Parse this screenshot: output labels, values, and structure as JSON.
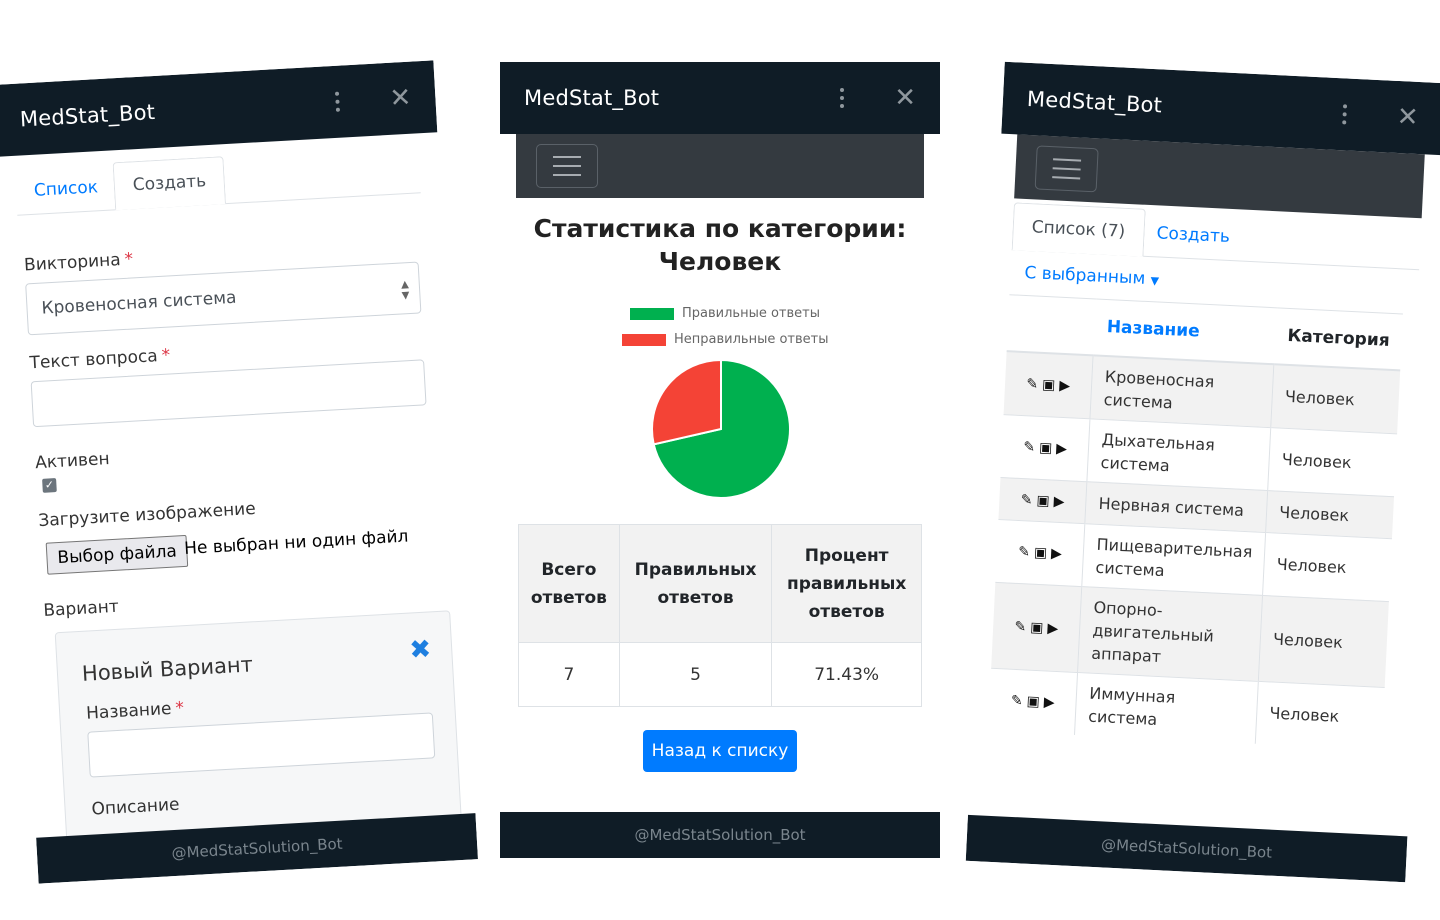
{
  "app_title": "MedStat_Bot",
  "footer_text": "@MedStatSolution_Bot",
  "colors": {
    "bar_bg": "#0f1c26",
    "navbar_bg": "#343a40",
    "primary": "#007bff",
    "correct": "#00b04f",
    "incorrect": "#f44336"
  },
  "form_screen": {
    "tabs": [
      "Список",
      "Создать"
    ],
    "quiz_label": "Викторина",
    "quiz_value": "Кровеносная система",
    "question_label": "Текст вопроса",
    "active_label": "Активен",
    "upload_label": "Загрузите изображение",
    "file_button": "Выбор файла",
    "file_status": "Не выбран ни один файл",
    "variant_label": "Вариант",
    "variant_card": {
      "title": "Новый Вариант",
      "name_label": "Название",
      "description_label": "Описание"
    }
  },
  "stats_screen": {
    "title_line1": "Статистика по категории:",
    "title_line2": "Человек",
    "legend": [
      "Правильные ответы",
      "Неправильные ответы"
    ],
    "table_headers": [
      [
        "Всего",
        "ответов"
      ],
      [
        "Правильных",
        "ответов"
      ],
      [
        "Процент",
        "правильных",
        "ответов"
      ]
    ],
    "table_values": [
      "7",
      "5",
      "71.43%"
    ],
    "back_button": "Назад к списку"
  },
  "chart_data": {
    "type": "pie",
    "categories": [
      "Правильные ответы",
      "Неправильные ответы"
    ],
    "values": [
      5,
      2
    ],
    "colors": [
      "#00b04f",
      "#f44336"
    ],
    "legend_position": "top"
  },
  "list_screen": {
    "tabs": [
      "Список (7)",
      "Создать"
    ],
    "bulk_dropdown": "С выбранным",
    "headers": [
      "Название",
      "Категория"
    ],
    "rows": [
      {
        "name": [
          "Кровеносная",
          "система"
        ],
        "category": "Человек"
      },
      {
        "name": [
          "Дыхательная",
          "система"
        ],
        "category": "Человек"
      },
      {
        "name": [
          "Нервная система"
        ],
        "category": "Человек"
      },
      {
        "name": [
          "Пищеварительная",
          "система"
        ],
        "category": "Человек"
      },
      {
        "name": [
          "Опорно-",
          "двигательный",
          "аппарат"
        ],
        "category": "Человек"
      },
      {
        "name": [
          "Иммунная",
          "система"
        ],
        "category": "Человек"
      }
    ],
    "row_action_icons": [
      "pencil-icon",
      "trash-icon",
      "play-icon"
    ]
  }
}
